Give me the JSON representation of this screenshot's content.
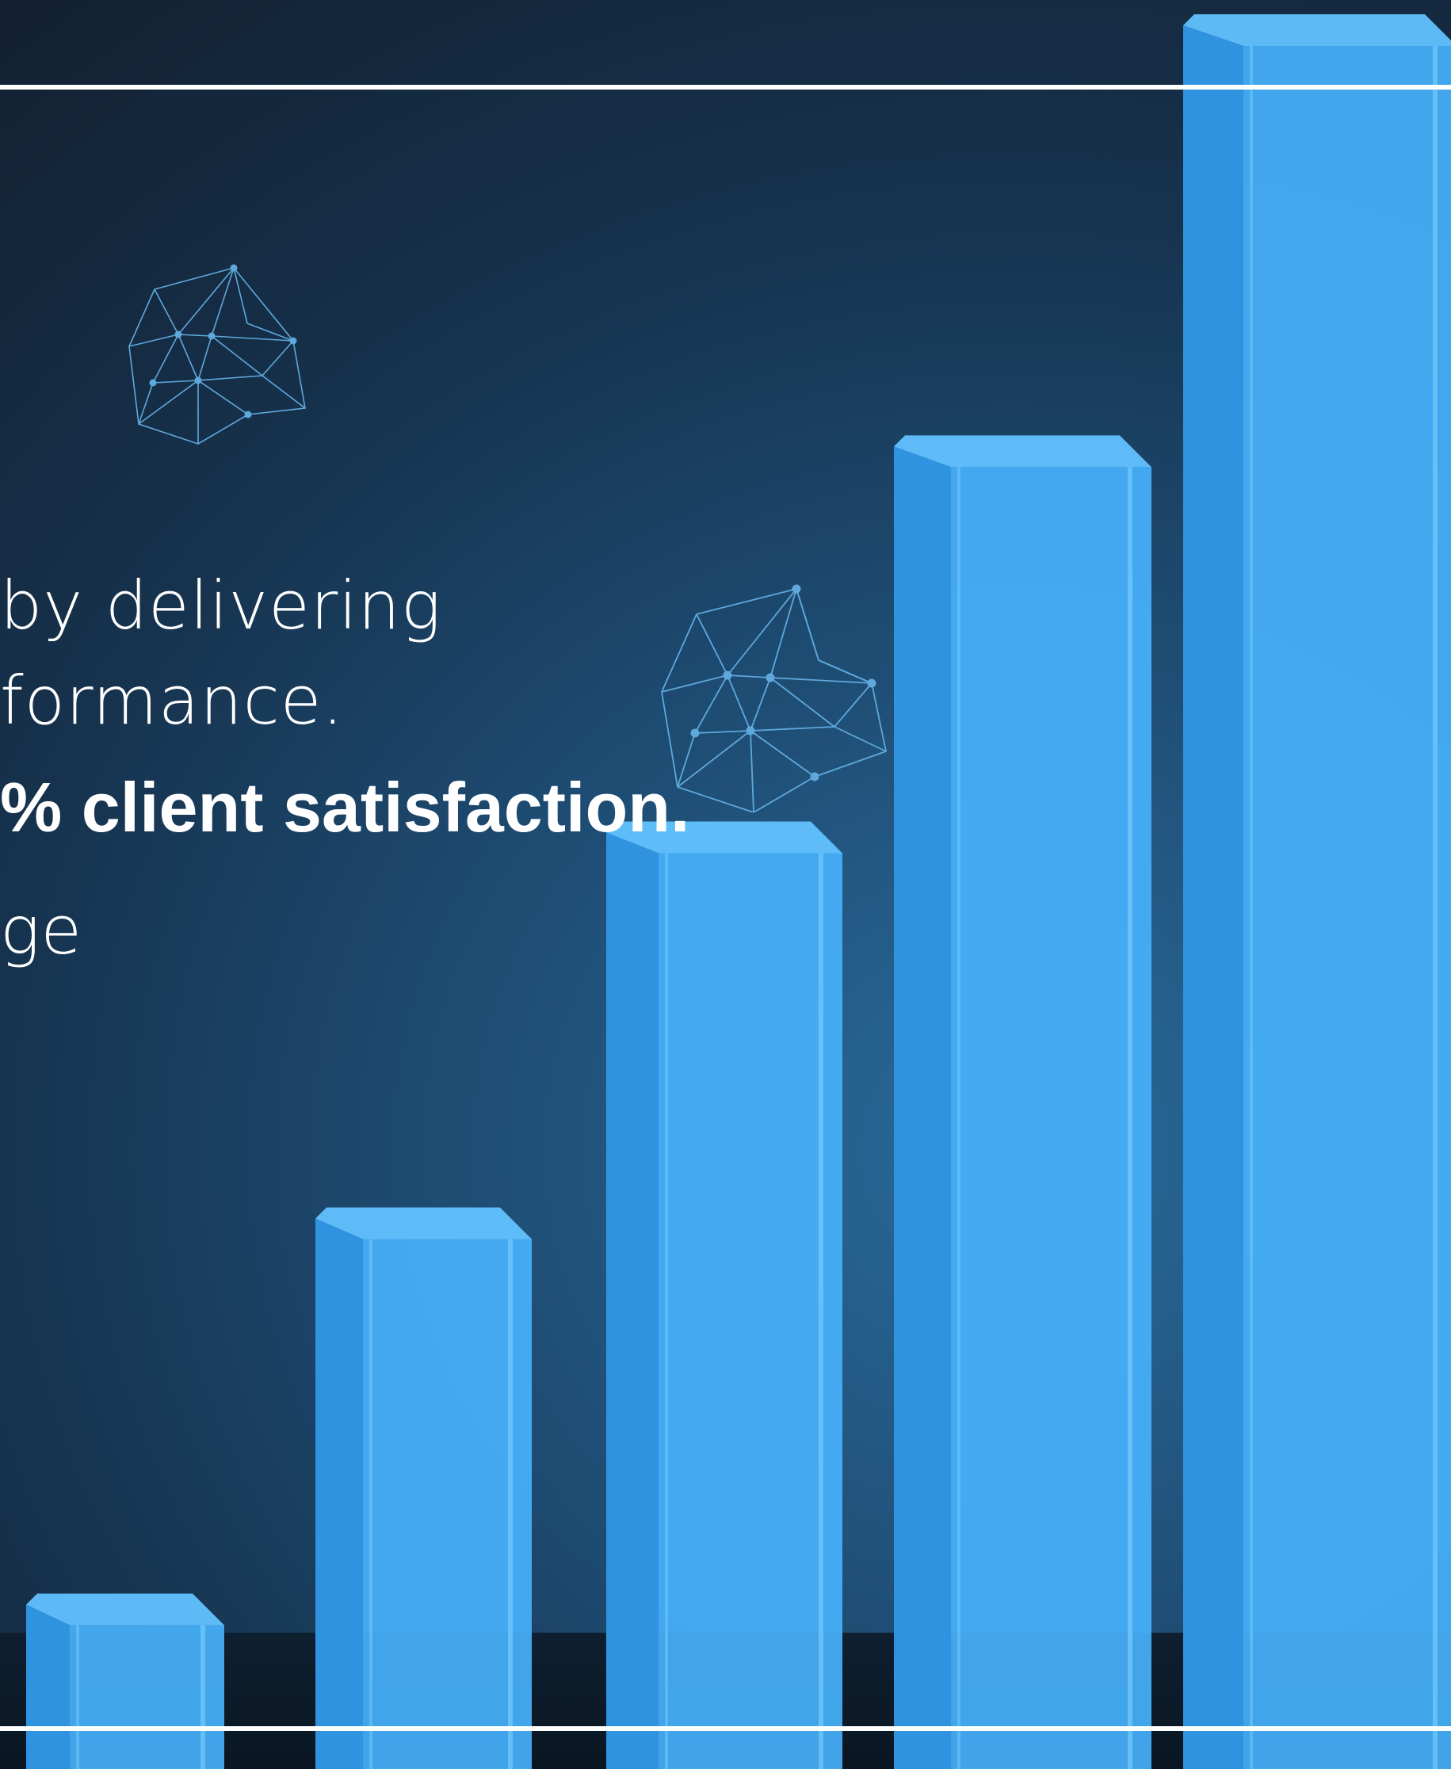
{
  "text": {
    "line1": "by delivering",
    "line2": "formance.",
    "line3": "% client satisfaction.",
    "line4": "ge"
  },
  "colors": {
    "bar_front": "#46b1fb",
    "bar_side": "#2f93e0",
    "bar_top": "#62c2ff",
    "network": "#5fa8dc",
    "frame_line": "#ffffff"
  },
  "icons": [
    "network-icon",
    "network-icon"
  ],
  "bars": [
    {
      "name": "bar-1",
      "level": 0.1
    },
    {
      "name": "bar-2",
      "level": 0.32
    },
    {
      "name": "bar-3",
      "level": 0.54
    },
    {
      "name": "bar-4",
      "level": 0.76
    },
    {
      "name": "bar-5",
      "level": 1.0
    }
  ]
}
